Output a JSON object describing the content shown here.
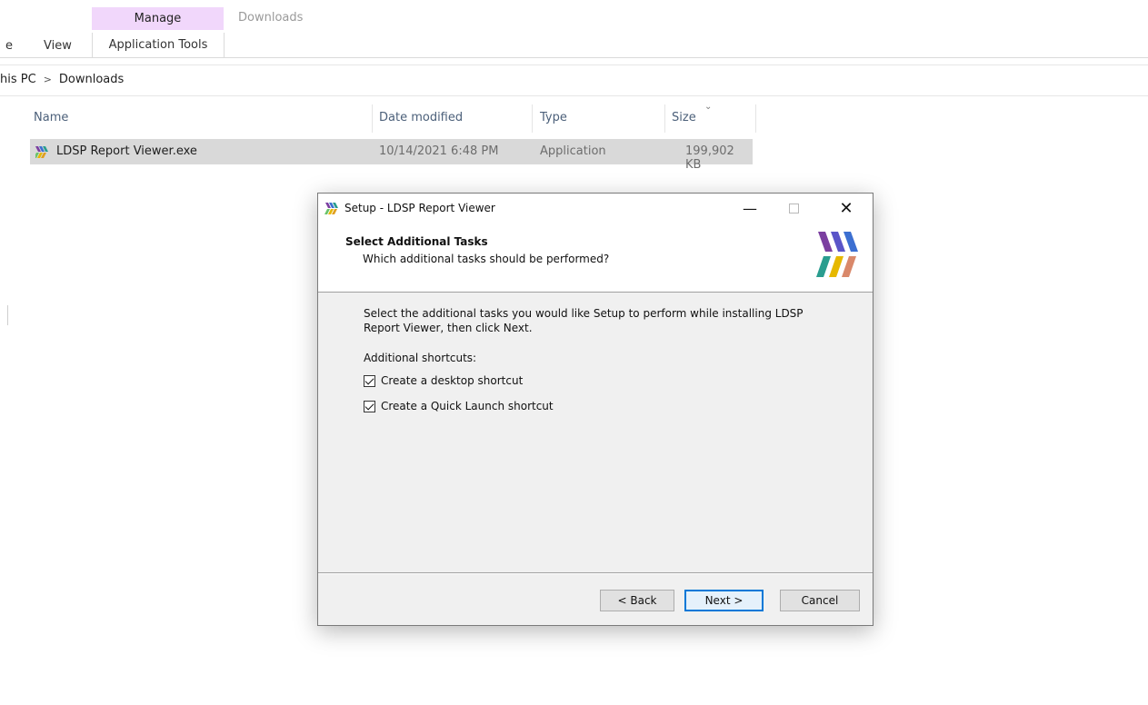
{
  "ribbon": {
    "manage_tab": "Manage",
    "window_title": "Downloads",
    "cut_tab": "e",
    "view_tab": "View",
    "context_tab": "Application Tools"
  },
  "breadcrumb": {
    "items": [
      "his PC",
      "Downloads"
    ],
    "separator": ">"
  },
  "file_list": {
    "columns": [
      "Name",
      "Date modified",
      "Type",
      "Size"
    ],
    "rows": [
      {
        "name": "LDSP Report Viewer.exe",
        "date": "10/14/2021 6:48 PM",
        "type": "Application",
        "size": "199,902 KB"
      }
    ]
  },
  "dialog": {
    "title": "Setup - LDSP Report Viewer",
    "header_title": "Select Additional Tasks",
    "header_subtitle": "Which additional tasks should be performed?",
    "body_text": "Select the additional tasks you would like Setup to perform while installing LDSP Report Viewer, then click Next.",
    "shortcuts_label": "Additional shortcuts:",
    "options": [
      {
        "label": "Create a desktop shortcut",
        "checked": true
      },
      {
        "label": "Create a Quick Launch shortcut",
        "checked": true
      }
    ],
    "buttons": {
      "back": "< Back",
      "next": "Next >",
      "cancel": "Cancel"
    }
  },
  "colors": {
    "manage_tab_bg": "#f1d7fb",
    "selected_row_bg": "#d9d9d9",
    "focus_blue": "#0078d7",
    "logo_colors": [
      "#7b3fa0",
      "#2a9d8f",
      "#e6b800",
      "#3c6fd1",
      "#6ac36a",
      "#e0a020"
    ]
  }
}
